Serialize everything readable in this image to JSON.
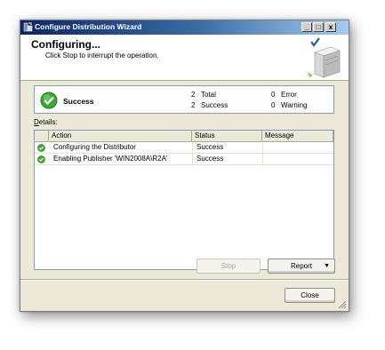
{
  "window": {
    "title": "Configure Distribution Wizard",
    "controls": {
      "minimize": "_",
      "maximize": "□",
      "close": "x"
    }
  },
  "header": {
    "title": "Configuring...",
    "subtitle": "Click Stop to interrupt the operation."
  },
  "summary": {
    "status": "Success",
    "total_count": "2",
    "total_label": "Total",
    "success_count": "2",
    "success_label": "Success",
    "error_count": "0",
    "error_label": "Error",
    "warning_count": "0",
    "warning_label": "Warning"
  },
  "details": {
    "label_prefix": "D",
    "label_rest": "etails:",
    "columns": [
      "Action",
      "Status",
      "Message"
    ],
    "rows": [
      {
        "action": "Configuring the Distributor",
        "status": "Success",
        "message": ""
      },
      {
        "action": "Enabling Publisher 'WIN2008A\\R2A'",
        "status": "Success",
        "message": ""
      }
    ]
  },
  "buttons": {
    "stop": "Stop",
    "report": "Report",
    "report_arrow": "▼",
    "close": "Close"
  },
  "icons": {
    "title": "wizard-icon",
    "header": "server-check-icon",
    "success": "success-check-icon"
  },
  "colors": {
    "title_gradient_start": "#0a246a",
    "success_green": "#3aa935",
    "dialog_bg": "#ece9d8"
  }
}
